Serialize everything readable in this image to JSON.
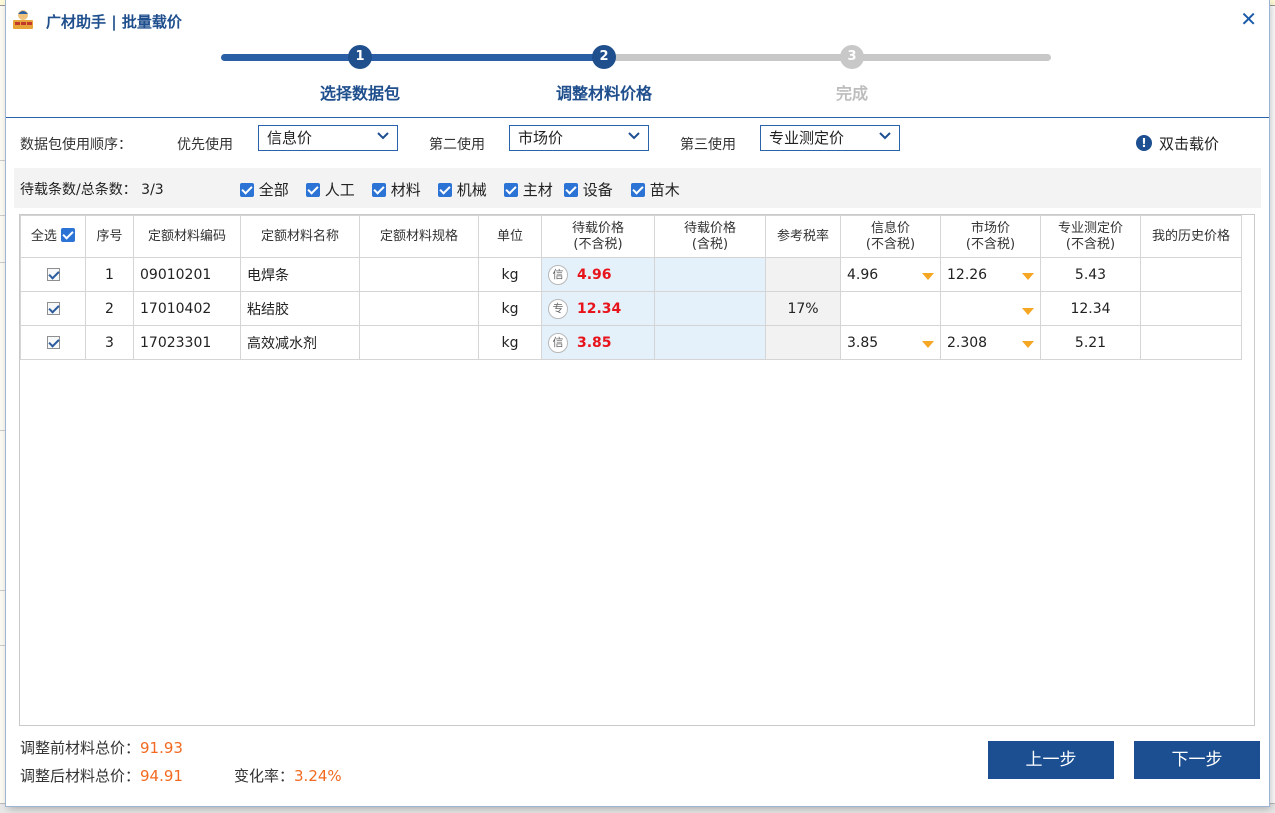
{
  "window": {
    "title": "广材助手 | 批量载价"
  },
  "steps": [
    {
      "num": "1",
      "label": "选择数据包"
    },
    {
      "num": "2",
      "label": "调整材料价格"
    },
    {
      "num": "3",
      "label": "完成"
    }
  ],
  "order": {
    "label": "数据包使用顺序：",
    "first_label": "优先使用",
    "first_value": "信息价",
    "second_label": "第二使用",
    "second_value": "市场价",
    "third_label": "第三使用",
    "third_value": "专业测定价",
    "hint": "双击载价"
  },
  "filter": {
    "count_label": "待载条数/总条数：",
    "count_value": "3/3",
    "options": [
      "全部",
      "人工",
      "材料",
      "机械",
      "主材",
      "设备",
      "苗木"
    ]
  },
  "table": {
    "select_all": "全选",
    "headers": {
      "no": "序号",
      "code": "定额材料编码",
      "name": "定额材料名称",
      "spec": "定额材料规格",
      "unit": "单位",
      "pend_notax_1": "待载价格",
      "pend_notax_2": "(不含税)",
      "pend_tax_1": "待载价格",
      "pend_tax_2": "(含税)",
      "tax_rate": "参考税率",
      "info_1": "信息价",
      "info_2": "(不含税)",
      "market_1": "市场价",
      "market_2": "(不含税)",
      "pro_1": "专业测定价",
      "pro_2": "(不含税)",
      "history": "我的历史价格"
    },
    "rows": [
      {
        "no": "1",
        "code": "09010201",
        "name": "电焊条",
        "spec": "",
        "unit": "kg",
        "src": "信",
        "pend_notax": "4.96",
        "pend_tax": "",
        "tax_rate": "",
        "info": "4.96",
        "market": "12.26",
        "pro": "5.43",
        "history": ""
      },
      {
        "no": "2",
        "code": "17010402",
        "name": "粘结胶",
        "spec": "",
        "unit": "kg",
        "src": "专",
        "pend_notax": "12.34",
        "pend_tax": "",
        "tax_rate": "17%",
        "info": "",
        "market": "",
        "pro": "12.34",
        "history": ""
      },
      {
        "no": "3",
        "code": "17023301",
        "name": "高效减水剂",
        "spec": "",
        "unit": "kg",
        "src": "信",
        "pend_notax": "3.85",
        "pend_tax": "",
        "tax_rate": "",
        "info": "3.85",
        "market": "2.308",
        "pro": "5.21",
        "history": ""
      }
    ]
  },
  "footer": {
    "before_label": "调整前材料总价：",
    "before_value": "91.93",
    "after_label": "调整后材料总价：",
    "after_value": "94.91",
    "rate_label": "变化率：",
    "rate_value": "3.24%",
    "prev_button": "上一步",
    "next_button": "下一步"
  },
  "colors": {
    "accent": "#1b4f91",
    "progress_done": "#2b5fa5",
    "progress_todo": "#c8c8c8",
    "price_red": "#e8141b",
    "total_orange": "#f26a21"
  }
}
